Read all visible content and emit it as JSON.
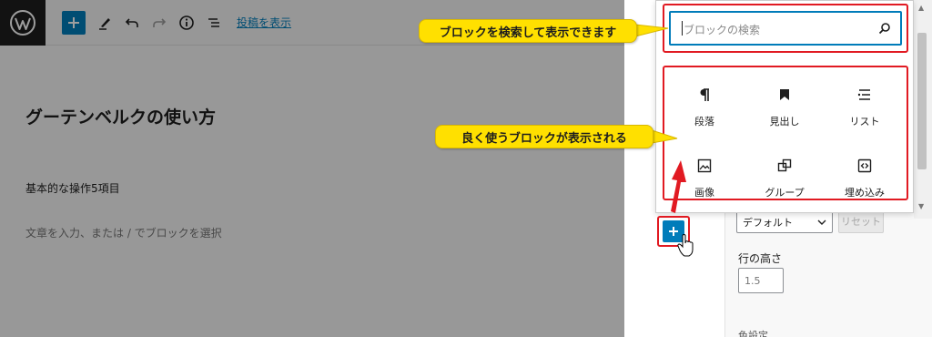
{
  "toolbar": {
    "preview_link": "投稿を表示"
  },
  "editor": {
    "title": "グーテンベルクの使い方",
    "paragraph": "基本的な操作5項目",
    "placeholder": "文章を入力、または / でブロックを選択"
  },
  "inserter": {
    "search_placeholder": "ブロックの検索",
    "blocks": [
      {
        "label": "段落",
        "icon": "paragraph-icon"
      },
      {
        "label": "見出し",
        "icon": "bookmark-icon"
      },
      {
        "label": "リスト",
        "icon": "list-icon"
      },
      {
        "label": "画像",
        "icon": "image-icon"
      },
      {
        "label": "グループ",
        "icon": "group-icon"
      },
      {
        "label": "埋め込み",
        "icon": "embed-icon"
      }
    ]
  },
  "settings": {
    "font_size_value": "デフォルト",
    "reset_label": "リセット",
    "line_height_label": "行の高さ",
    "line_height_placeholder": "1.5",
    "color_settings_label": "色設定"
  },
  "annotations": {
    "search_callout": "ブロックを検索して表示できます",
    "blocks_callout": "良く使うブロックが表示される"
  },
  "colors": {
    "accent": "#007cba",
    "annotation_red": "#e11a22",
    "callout_yellow": "#ffe000"
  }
}
